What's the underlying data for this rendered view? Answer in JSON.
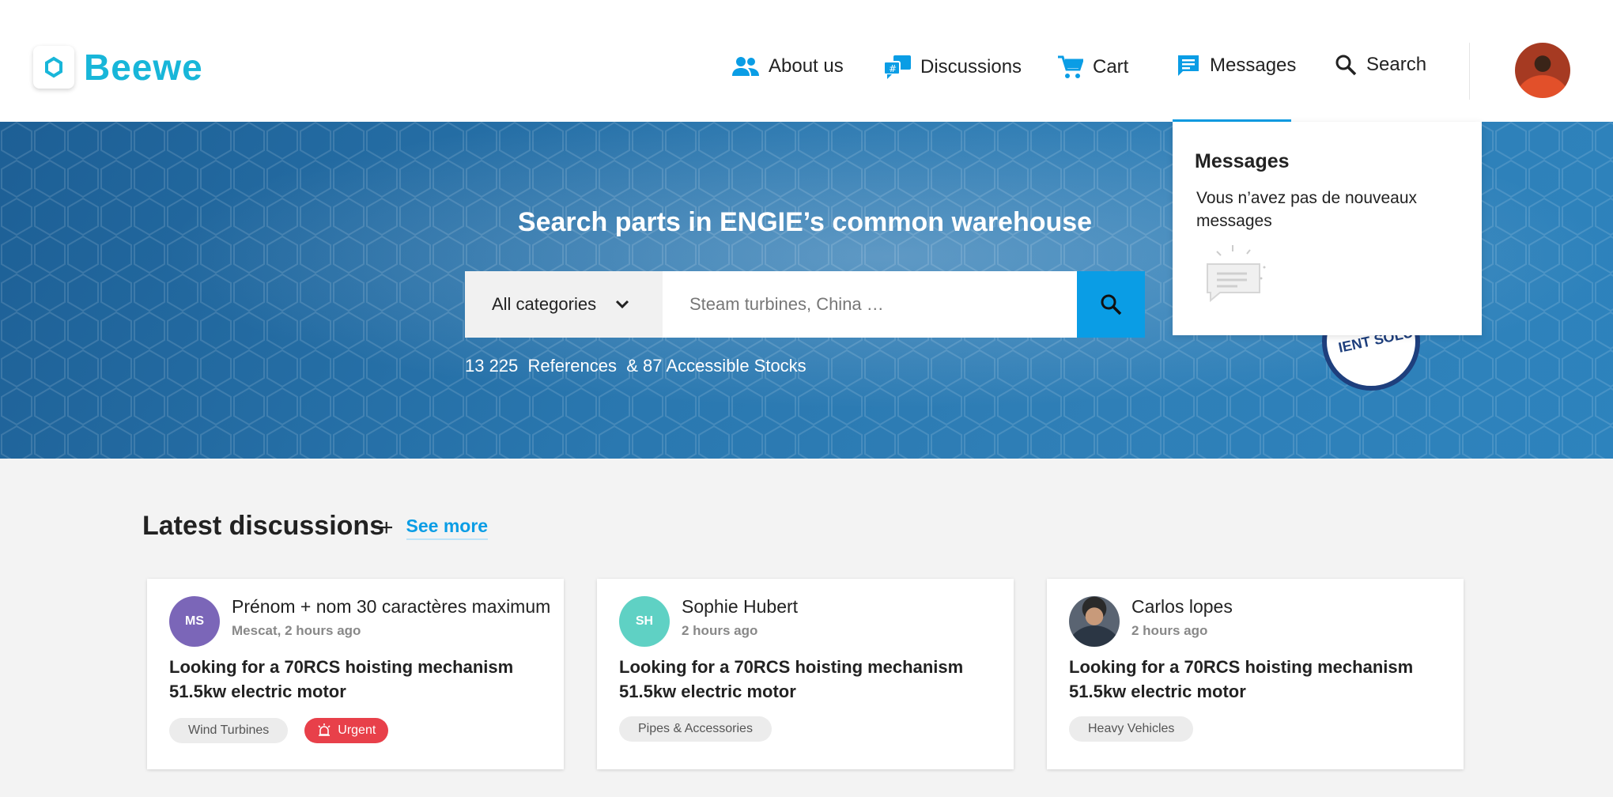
{
  "brand": {
    "name": "Beewe",
    "accent": "#0a9de5",
    "logo_color": "#18b6d9"
  },
  "nav": {
    "about": "About us",
    "discussions": "Discussions",
    "cart": "Cart",
    "messages": "Messages",
    "search": "Search"
  },
  "hero": {
    "title": "Search parts in ENGIE’s common warehouse",
    "category_select": "All categories",
    "search_placeholder": "Steam turbines, China …",
    "stats": "13 225  References  & 87 Accessible Stocks",
    "seal_text": "IENT SOLU"
  },
  "messages_dropdown": {
    "title": "Messages",
    "empty_text": "Vous n’avez pas de nouveaux messages"
  },
  "discussions": {
    "title": "Latest discussions",
    "see_more": "See more",
    "cards": [
      {
        "initials": "MS",
        "avatar_color": "#7b66b8",
        "name": "Prénom + nom 30 caractères maximum",
        "meta": "Mescat, 2 hours ago",
        "title": "Looking for a 70RCS hoisting mechanism 51.5kw electric motor",
        "tags": [
          "Wind Turbines"
        ],
        "urgent": "Urgent"
      },
      {
        "initials": "SH",
        "avatar_color": "#5fd1c4",
        "name": "Sophie Hubert",
        "meta": "2 hours ago",
        "title": "Looking for a 70RCS hoisting mechanism 51.5kw electric motor",
        "tags": [
          "Pipes & Accessories"
        ]
      },
      {
        "initials": "",
        "avatar_color": "#3c4450",
        "name": "Carlos lopes",
        "meta": "2 hours ago",
        "title": "Looking for a 70RCS hoisting mechanism 51.5kw electric motor",
        "tags": [
          "Heavy Vehicles"
        ]
      }
    ]
  }
}
